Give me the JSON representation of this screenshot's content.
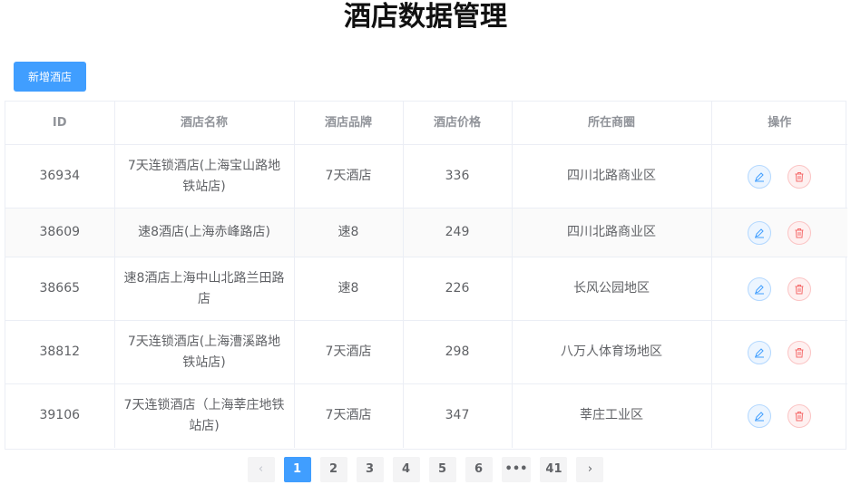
{
  "page": {
    "title": "酒店数据管理"
  },
  "toolbar": {
    "add_label": "新增酒店"
  },
  "table": {
    "headers": [
      "ID",
      "酒店名称",
      "酒店品牌",
      "酒店价格",
      "所在商圈",
      "操作"
    ],
    "rows": [
      {
        "id": "36934",
        "name": "7天连锁酒店(上海宝山路地铁站店)",
        "brand": "7天酒店",
        "price": "336",
        "area": "四川北路商业区"
      },
      {
        "id": "38609",
        "name": "速8酒店(上海赤峰路店)",
        "brand": "速8",
        "price": "249",
        "area": "四川北路商业区"
      },
      {
        "id": "38665",
        "name": "速8酒店上海中山北路兰田路店",
        "brand": "速8",
        "price": "226",
        "area": "长风公园地区"
      },
      {
        "id": "38812",
        "name": "7天连锁酒店(上海漕溪路地铁站店)",
        "brand": "7天酒店",
        "price": "298",
        "area": "八万人体育场地区"
      },
      {
        "id": "39106",
        "name": "7天连锁酒店（上海莘庄地铁站店)",
        "brand": "7天酒店",
        "price": "347",
        "area": "莘庄工业区"
      }
    ]
  },
  "icons": {
    "edit": "edit-icon",
    "delete": "trash-icon",
    "prev": "chevron-left-icon",
    "next": "chevron-right-icon"
  },
  "colors": {
    "primary": "#409eff",
    "danger": "#f56c6c"
  },
  "pagination": {
    "prev": "‹",
    "pages": [
      "1",
      "2",
      "3",
      "4",
      "5",
      "6"
    ],
    "ellipsis": "•••",
    "last": "41",
    "next": "›",
    "current": "1"
  }
}
